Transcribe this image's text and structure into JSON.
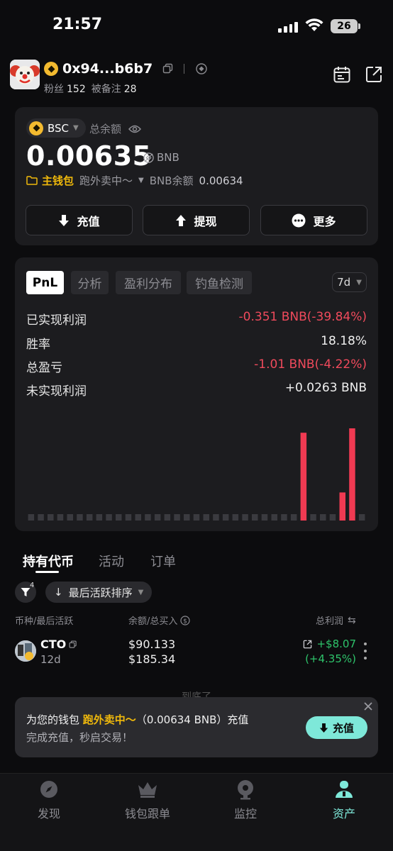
{
  "status_bar": {
    "time": "21:57",
    "battery": "26"
  },
  "header": {
    "address": "0x94...b6b7",
    "fans_label": "粉丝",
    "fans_count": "152",
    "noted_label": "被备注",
    "noted_count": "28"
  },
  "balance": {
    "chain": "BSC",
    "total_label": "总余额",
    "amount": "0.00635",
    "unit": "BNB",
    "wallet_main": "主钱包",
    "wallet_name": "跑外卖中～",
    "bnb_balance_label": "BNB余额",
    "bnb_balance_value": "0.00634",
    "buttons": {
      "deposit": "充值",
      "withdraw": "提现",
      "more": "更多"
    }
  },
  "pnl": {
    "tabs": [
      "PnL",
      "分析",
      "盈利分布",
      "钓鱼检测"
    ],
    "period": "7d",
    "stats": [
      {
        "label": "已实现利润",
        "value": "-0.351 BNB(-39.84%)",
        "tone": "red"
      },
      {
        "label": "胜率",
        "value": "18.18%",
        "tone": "white"
      },
      {
        "label": "总盈亏",
        "value": "-1.01 BNB(-4.22%)",
        "tone": "red"
      },
      {
        "label": "未实现利润",
        "value": "+0.0263 BNB",
        "tone": "white"
      }
    ]
  },
  "chart_data": {
    "type": "bar",
    "values": [
      0,
      0,
      0,
      0,
      0,
      0,
      0,
      0,
      0,
      0,
      0,
      0,
      0,
      0,
      0,
      0,
      0,
      0,
      0,
      0,
      0,
      0,
      0,
      0,
      0,
      0,
      0,
      0,
      1.0,
      0,
      0,
      0,
      0.32,
      1.05,
      0
    ],
    "colors": {
      "positive": "#f03a52",
      "empty": "#3a3a3f"
    }
  },
  "holdings": {
    "tabs": [
      "持有代币",
      "活动",
      "订单"
    ],
    "filter_count": "4",
    "sort_label": "最后活跃排序",
    "columns": {
      "token": "币种/最后活跃",
      "balance": "余额/总买入",
      "pnl": "总利润"
    },
    "rows": [
      {
        "name": "CTO",
        "age": "12d",
        "balance": "$90.133",
        "bought": "$185.34",
        "pnl": "+$8.07",
        "pnl_pct": "(+4.35%)"
      }
    ],
    "end_text": "到底了"
  },
  "toast": {
    "prefix": "为您的钱包",
    "wallet": "跑外卖中～",
    "suffix": "（0.00634 BNB）充值",
    "line2": "完成充值，秒启交易！",
    "button": "充值"
  },
  "bottom_nav": [
    {
      "label": "发现",
      "icon": "compass-icon"
    },
    {
      "label": "钱包跟单",
      "icon": "crown-icon"
    },
    {
      "label": "监控",
      "icon": "monitor-icon"
    },
    {
      "label": "资产",
      "icon": "person-icon",
      "active": true
    }
  ],
  "colors": {
    "accent": "#7ee8d9",
    "brand_yellow": "#f0b90b",
    "loss": "#f04a5c",
    "gain": "#2ec46b"
  }
}
